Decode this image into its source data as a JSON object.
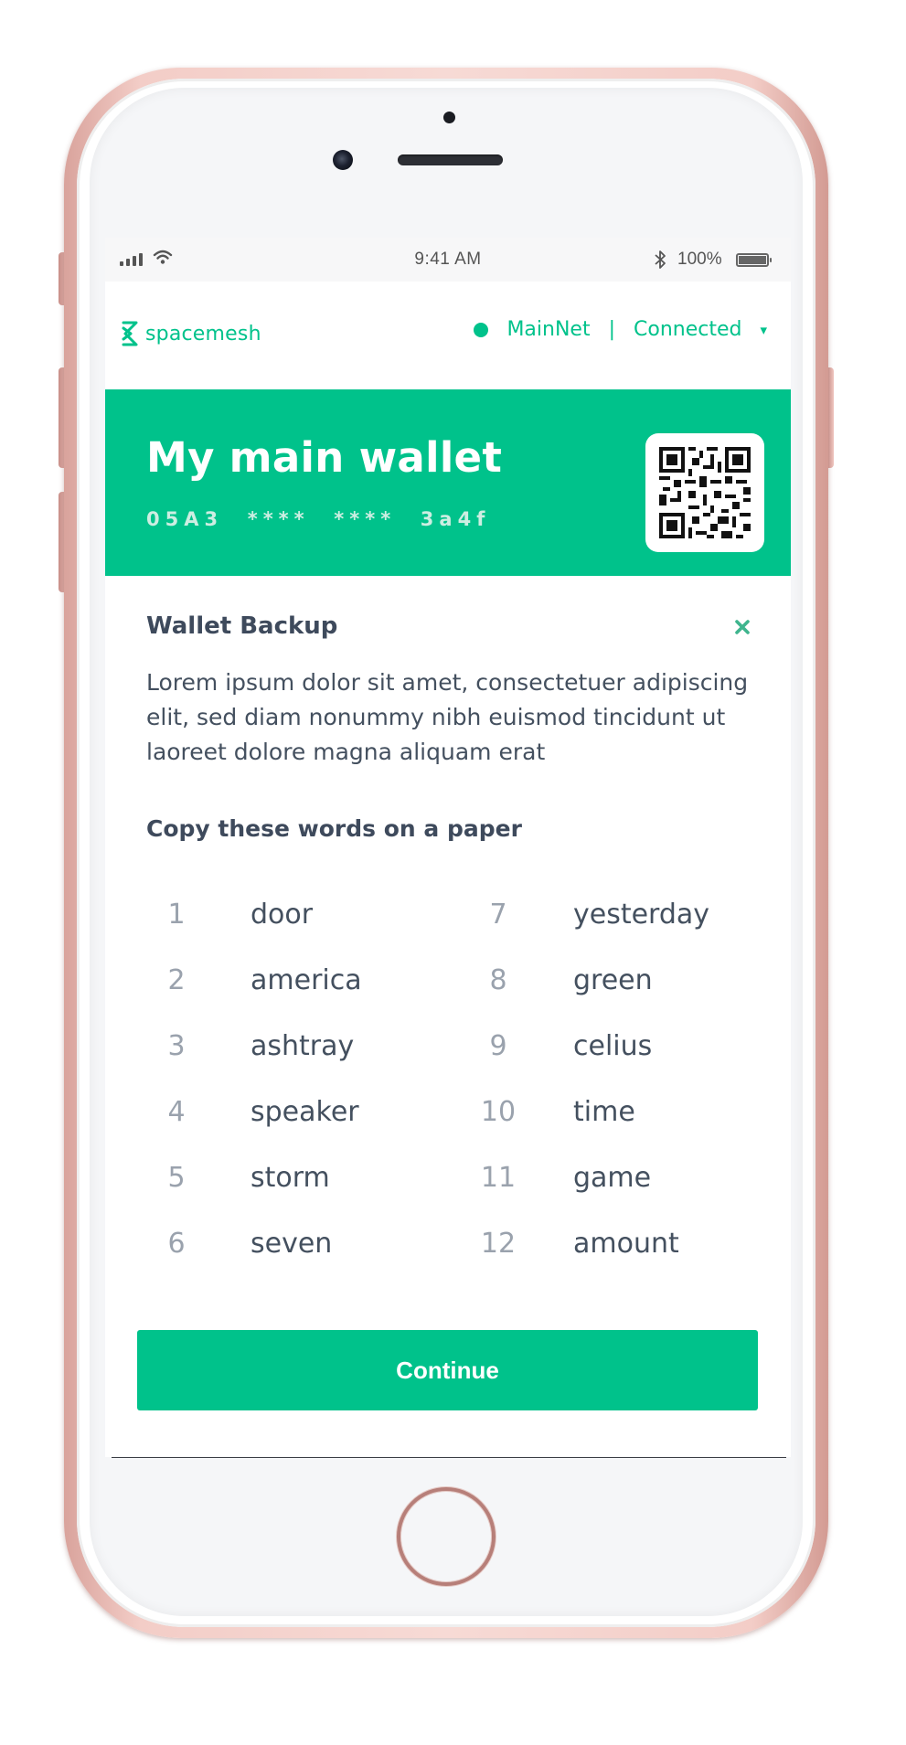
{
  "status_bar": {
    "time": "9:41 AM",
    "battery": "100%",
    "icons": [
      "signal-icon",
      "wifi-icon",
      "bluetooth-icon",
      "battery-icon"
    ]
  },
  "header": {
    "brand": "spacemesh",
    "network": "MainNet",
    "separator": "|",
    "connection": "Connected",
    "dropdown_icon": "▾"
  },
  "wallet": {
    "title": "My main wallet",
    "address": "05A3  ****  ****  3a4f",
    "qr_icon": "qr-code-icon"
  },
  "backup": {
    "title": "Wallet Backup",
    "close_icon": "✖",
    "description": "Lorem ipsum dolor sit amet, consectetuer adipiscing elit, sed diam nonummy nibh euismod tincidunt ut laoreet dolore magna aliquam erat",
    "copy_title": "Copy these words on  a paper",
    "words": [
      {
        "num": "1",
        "word": "door"
      },
      {
        "num": "2",
        "word": "america"
      },
      {
        "num": "3",
        "word": "ashtray"
      },
      {
        "num": "4",
        "word": "speaker"
      },
      {
        "num": "5",
        "word": "storm"
      },
      {
        "num": "6",
        "word": "seven"
      },
      {
        "num": "7",
        "word": "yesterday"
      },
      {
        "num": "8",
        "word": "green"
      },
      {
        "num": "9",
        "word": "celius"
      },
      {
        "num": "10",
        "word": "time"
      },
      {
        "num": "11",
        "word": "game"
      },
      {
        "num": "12",
        "word": "amount"
      }
    ],
    "continue_label": "Continue"
  },
  "colors": {
    "accent": "#00c28b",
    "text_dark": "#3e4a5c",
    "text_muted": "#9aa2ad"
  }
}
